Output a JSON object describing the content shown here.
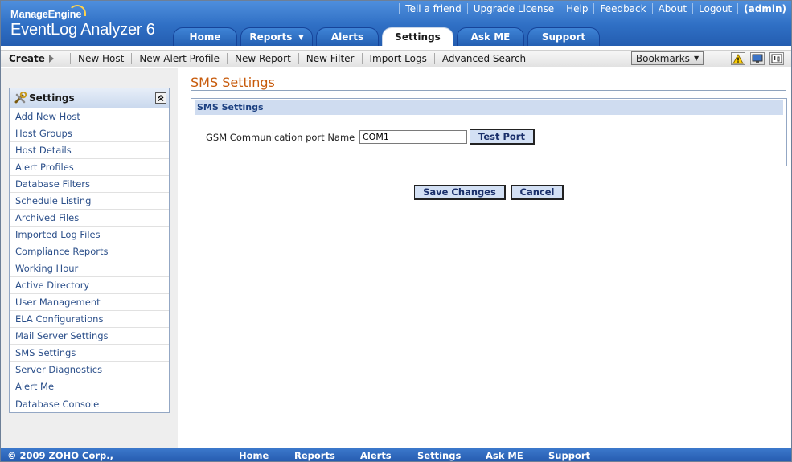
{
  "app": {
    "logo_top": "ManageEngine",
    "logo_main": "EventLog Analyzer 6"
  },
  "top_links": {
    "tell_friend": "Tell a friend",
    "upgrade": "Upgrade License",
    "help": "Help",
    "feedback": "Feedback",
    "about": "About",
    "logout": "Logout",
    "user": "(admin)"
  },
  "tabs": [
    {
      "label": "Home"
    },
    {
      "label": "Reports"
    },
    {
      "label": "Alerts"
    },
    {
      "label": "Settings"
    },
    {
      "label": "Ask ME"
    },
    {
      "label": "Support"
    }
  ],
  "toolbar": {
    "create_label": "Create",
    "items": [
      "New Host",
      "New Alert Profile",
      "New Report",
      "New Filter",
      "Import Logs",
      "Advanced Search"
    ],
    "bookmarks_label": "Bookmarks"
  },
  "sidebar": {
    "title": "Settings",
    "items": [
      {
        "label": "Add New Host"
      },
      {
        "label": "Host Groups"
      },
      {
        "label": "Host Details"
      },
      {
        "label": "Alert Profiles"
      },
      {
        "label": "Database Filters"
      },
      {
        "label": "Schedule Listing"
      },
      {
        "label": "Archived Files"
      },
      {
        "label": "Imported Log Files"
      },
      {
        "label": "Compliance Reports"
      },
      {
        "label": "Working Hour"
      },
      {
        "label": "Active Directory"
      },
      {
        "label": "User Management"
      },
      {
        "label": "ELA Configurations"
      },
      {
        "label": "Mail Server Settings"
      },
      {
        "label": "SMS Settings"
      },
      {
        "label": "Server Diagnostics"
      },
      {
        "label": "Alert Me"
      },
      {
        "label": "Database Console"
      }
    ]
  },
  "main": {
    "page_title": "SMS Settings",
    "section_title": "SMS Settings",
    "port_label": "GSM Communication port Name :",
    "port_value": "COM1",
    "test_port_label": "Test Port",
    "save_label": "Save Changes",
    "cancel_label": "Cancel"
  },
  "footer": {
    "copyright": "© 2009 ZOHO Corp.,",
    "links": [
      "Home",
      "Reports",
      "Alerts",
      "Settings",
      "Ask ME",
      "Support"
    ]
  },
  "colors": {
    "header_blue": "#2f6fc4",
    "title_orange": "#c75a0a",
    "button_fill": "#d3e0f4"
  }
}
